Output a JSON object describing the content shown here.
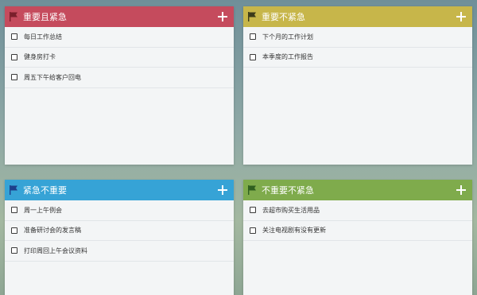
{
  "colors": {
    "urgent_important": "#c54b5d",
    "important_not_urgent": "#c7b64a",
    "urgent_not_important": "#36a3d6",
    "not_urgent_not_important": "#7fab4c"
  },
  "quadrants": [
    {
      "title": "重要且紧急",
      "flag_color": "#7a1f2b",
      "icons": {
        "flag": "flag-icon",
        "add": "plus-icon"
      },
      "tasks": [
        "每日工作总结",
        "健身房打卡",
        "周五下午给客户回电"
      ]
    },
    {
      "title": "重要不紧急",
      "flag_color": "#3b3a1a",
      "icons": {
        "flag": "flag-icon",
        "add": "plus-icon"
      },
      "tasks": [
        "下个月的工作计划",
        "本季度的工作报告"
      ]
    },
    {
      "title": "紧急不重要",
      "flag_color": "#1d3f8a",
      "icons": {
        "flag": "flag-icon",
        "add": "plus-icon"
      },
      "tasks": [
        "周一上午例会",
        "准备研讨会的发言稿",
        "打印周回上午会议资料"
      ]
    },
    {
      "title": "不重要不紧急",
      "flag_color": "#2f5f1f",
      "icons": {
        "flag": "flag-icon",
        "add": "plus-icon"
      },
      "tasks": [
        "去超市购买生活用品",
        "关注电视剧有没有更新"
      ]
    }
  ]
}
